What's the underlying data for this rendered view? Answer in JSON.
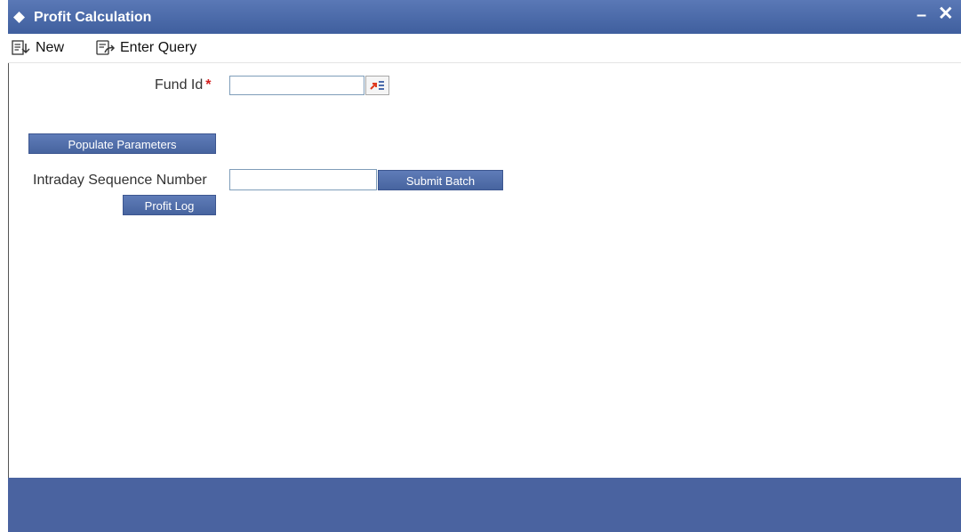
{
  "window": {
    "title": "Profit Calculation",
    "minimize_label": "–",
    "close_label": "✕"
  },
  "toolbar": {
    "new_label": "New",
    "enter_query_label": "Enter Query"
  },
  "form": {
    "fund_id_label": "Fund Id",
    "fund_id_required_mark": "*",
    "fund_id_value": "",
    "populate_parameters_label": "Populate Parameters",
    "intraday_sequence_label": "Intraday Sequence Number",
    "intraday_sequence_value": "",
    "submit_batch_label": "Submit Batch",
    "profit_log_label": "Profit Log"
  },
  "colors": {
    "titlebar": "#4a68a8",
    "button": "#536fab",
    "footer": "#4a63a0",
    "required": "#d32020"
  },
  "icons": {
    "title": "diamond-icon",
    "new": "new-document-icon",
    "enter_query": "enter-query-icon",
    "lov": "list-of-values-icon"
  }
}
